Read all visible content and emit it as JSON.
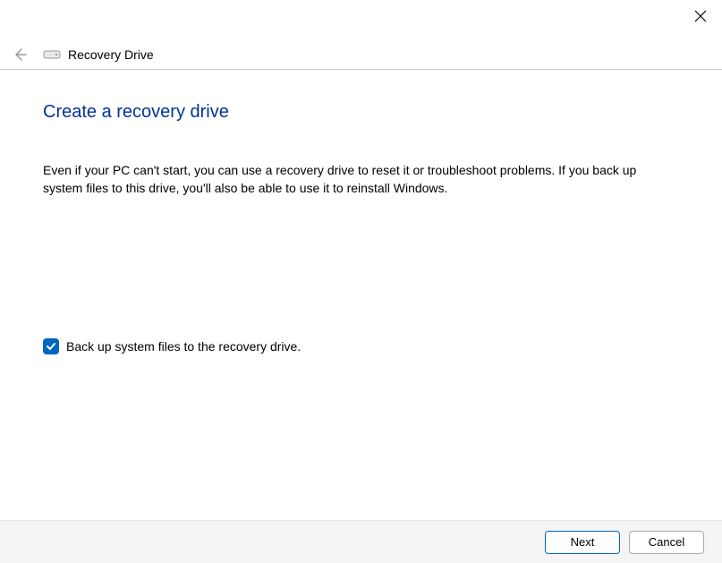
{
  "header": {
    "title": "Recovery Drive"
  },
  "page": {
    "title": "Create a recovery drive",
    "description": "Even if your PC can't start, you can use a recovery drive to reset it or troubleshoot problems. If you back up system files to this drive, you'll also be able to use it to reinstall Windows."
  },
  "checkbox": {
    "label": "Back up system files to the recovery drive.",
    "checked": true
  },
  "footer": {
    "next": "Next",
    "cancel": "Cancel"
  }
}
